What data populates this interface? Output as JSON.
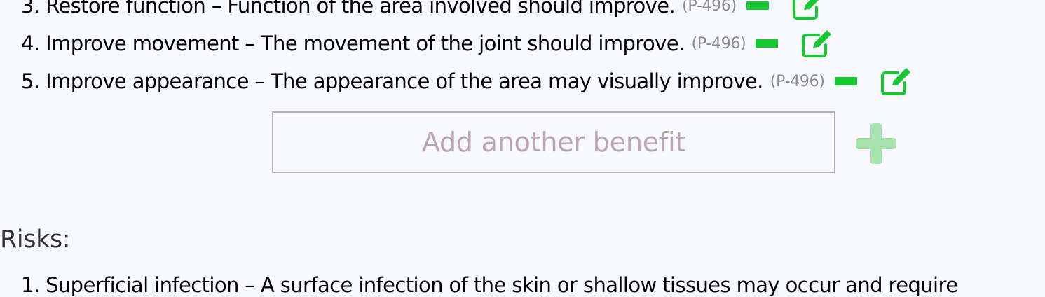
{
  "benefits": [
    {
      "text": "3. Restore function – Function of the area involved should improve.",
      "ref": "(P-496)"
    },
    {
      "text": "4. Improve movement – The movement of the joint should improve.",
      "ref": "(P-496)"
    },
    {
      "text": "5. Improve appearance – The appearance of the area may visually improve.",
      "ref": "(P-496)"
    }
  ],
  "add_benefit": {
    "placeholder": "Add another benefit"
  },
  "risks": {
    "label": "Risks:",
    "items": [
      {
        "text": "1. Superficial infection – A surface infection of the skin or shallow tissues may occur and require"
      }
    ]
  },
  "colors": {
    "accent_green": "#17c92f",
    "plus_green": "#a8e3af",
    "ref_grey": "#8a8a8a"
  }
}
